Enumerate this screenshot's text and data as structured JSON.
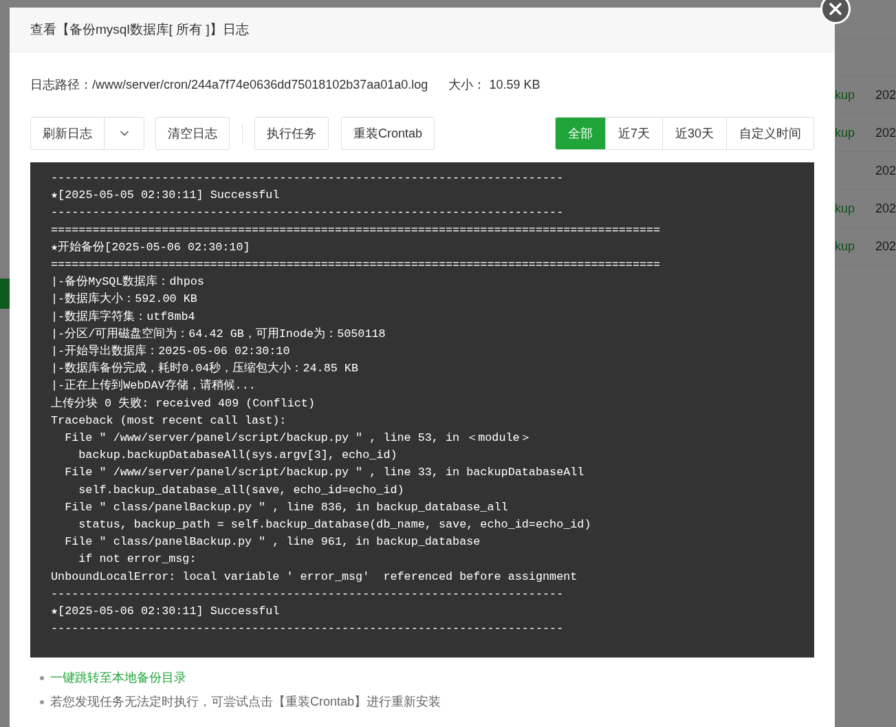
{
  "background": {
    "rows": [
      {
        "name": "kup",
        "time": "202"
      },
      {
        "name": "kup",
        "time": "202"
      },
      {
        "name": "",
        "time": "202"
      },
      {
        "name": "kup",
        "time": "202"
      },
      {
        "name": "kup",
        "time": "202"
      }
    ]
  },
  "dialog": {
    "title": "查看【备份mysql数据库[ 所有 ]】日志",
    "path_label": "日志路径：",
    "path": "/www/server/cron/244a7f74e0636dd75018102b37aa01a0.log",
    "size_label": "大小：",
    "size": "10.59 KB",
    "actions": [
      {
        "label": "刷新日志",
        "kind": "split"
      },
      {
        "label": "清空日志",
        "kind": "plain"
      },
      {
        "label": "执行任务",
        "kind": "plain"
      },
      {
        "label": "重装Crontab",
        "kind": "plain"
      }
    ],
    "ranges": [
      {
        "label": "全部",
        "selected": true
      },
      {
        "label": "近7天",
        "selected": false
      },
      {
        "label": "近30天",
        "selected": false
      },
      {
        "label": "自定义时间",
        "selected": false
      }
    ],
    "log_lines": [
      "--------------------------------------------------------------------------",
      "★[2025-05-05 02:30:11] Successful",
      "--------------------------------------------------------------------------",
      "========================================================================================",
      "★开始备份[2025-05-06 02:30:10]",
      "========================================================================================",
      "|-备份MySQL数据库：dhpos",
      "|-数据库大小：592.00 KB",
      "|-数据库字符集：utf8mb4",
      "|-分区/可用磁盘空间为：64.42 GB，可用Inode为：5050118",
      "|-开始导出数据库：2025-05-06 02:30:10",
      "|-数据库备份完成，耗时0.04秒，压缩包大小：24.85 KB",
      "|-正在上传到WebDAV存储，请稍候...",
      "上传分块 0 失败: received 409 (Conflict)",
      "Traceback (most recent call last):",
      "  File \" /www/server/panel/script/backup.py \" , line 53, in ＜module＞",
      "    backup.backupDatabaseAll(sys.argv[3], echo_id)",
      "  File \" /www/server/panel/script/backup.py \" , line 33, in backupDatabaseAll",
      "    self.backup_database_all(save, echo_id=echo_id)",
      "  File \" class/panelBackup.py \" , line 836, in backup_database_all",
      "    status, backup_path = self.backup_database(db_name, save, echo_id=echo_id)",
      "  File \" class/panelBackup.py \" , line 961, in backup_database",
      "    if not error_msg:",
      "UnboundLocalError: local variable ′ error_msg′  referenced before assignment",
      "--------------------------------------------------------------------------",
      "★[2025-05-06 02:30:11] Successful",
      "--------------------------------------------------------------------------"
    ],
    "tips": [
      {
        "text": "一键跳转至本地备份目录",
        "kind": "link"
      },
      {
        "text": "若您发现任务无法定时执行，可尝试点击【重装Crontab】进行重新安装",
        "kind": "text"
      }
    ]
  }
}
